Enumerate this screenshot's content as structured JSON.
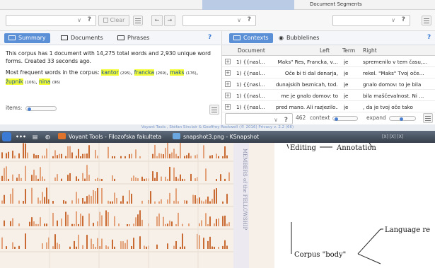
{
  "top": {
    "segments_title": "Document Segments"
  },
  "toolbar": {
    "clear_label": "Clear",
    "help_glyph": "?",
    "chevron_glyph": "∨"
  },
  "summary_panel": {
    "tabs": [
      {
        "label": "Summary",
        "active": true
      },
      {
        "label": "Documents",
        "active": false
      },
      {
        "label": "Phrases",
        "active": false
      }
    ],
    "help": "?",
    "corpus_text": "This corpus has 1 document with 14,275 total words and 2,930 unique word forms. Created 33 seconds ago.",
    "frequent_prefix": "Most frequent words in the corpus:",
    "frequent_words": [
      {
        "word": "kantor",
        "count": "(295)"
      },
      {
        "word": "francka",
        "count": "(269)"
      },
      {
        "word": "maks",
        "count": "(176)"
      },
      {
        "word": "župnik",
        "count": "(106)"
      },
      {
        "word": "nina",
        "count": "(96)"
      }
    ],
    "items_label": "items:"
  },
  "contexts_panel": {
    "tabs": [
      {
        "label": "Contexts",
        "active": true
      },
      {
        "label": "Bubblelines",
        "active": false
      }
    ],
    "help": "?",
    "columns": [
      "Document",
      "Left",
      "Term",
      "Right"
    ],
    "rows": [
      {
        "doc": "1) {{nasl…",
        "left": "Maks\" Res, Francka, v…",
        "term": "je",
        "right": "spremenilo v tem času,…"
      },
      {
        "doc": "1) {{nasl…",
        "left": "Oče bi ti dal denarja,",
        "term": "je",
        "right": "rekel. \"Maks\" Tvoj oče…"
      },
      {
        "doc": "1) {{nasl…",
        "left": "dunajskih beznicah, tod…",
        "term": "je",
        "right": "gnalo domov: to je bila"
      },
      {
        "doc": "1) {{nasl…",
        "left": "me je gnalo domov: to",
        "term": "je",
        "right": "bila maščevalnost. Ni …"
      },
      {
        "doc": "1) {{nasl…",
        "left": "pred mano. Ali razjezilo…",
        "term": "je",
        "right": ", da je tvoj oče tako"
      }
    ],
    "footer": {
      "help": "?",
      "count": "462",
      "context_label": "context",
      "expand_label": "expand"
    }
  },
  "credit": "Voyant Tools , Stéfan Sinclair & Geoffrey Rockwell (© 2016) Privacy v. 2.2 (66)",
  "taskbar": {
    "dots": "•••",
    "items": [
      {
        "label": "Voyant Tools - Filozofska fakulteta"
      },
      {
        "label": "snapshot3.png - KSnapshot"
      }
    ],
    "clock_partial": "[X] [X] [X]"
  },
  "heatmap": {
    "vertical_caption": "MEMBERS of the FELLOWSHIP",
    "colors": {
      "bar": "#c96a32",
      "bar_light": "#e3a27a",
      "bg": "#f6f0e8"
    }
  },
  "diagram": {
    "labels": [
      "Editing",
      "Annotation",
      "Language re",
      "Corpus \"body\""
    ]
  }
}
